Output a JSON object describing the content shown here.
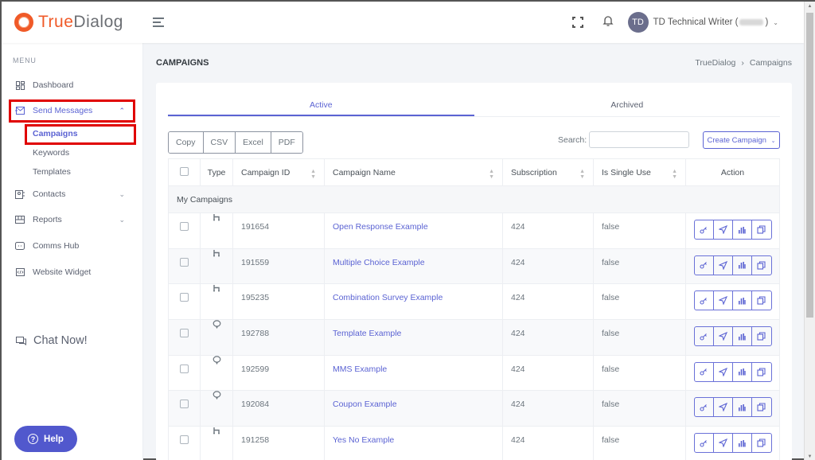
{
  "header": {
    "logo": {
      "part1": "True",
      "part2": "Dialog"
    },
    "user": {
      "initials": "TD",
      "name": "TD Technical Writer (",
      "suffix": ")"
    }
  },
  "sidebar": {
    "menu_title": "MENU",
    "items": [
      {
        "label": "Dashboard",
        "icon": "dashboard-icon"
      },
      {
        "label": "Send Messages",
        "icon": "send-messages-icon",
        "expanded": true,
        "active": true
      },
      {
        "label": "Contacts",
        "icon": "contacts-icon"
      },
      {
        "label": "Reports",
        "icon": "reports-icon"
      },
      {
        "label": "Comms Hub",
        "icon": "comms-hub-icon"
      },
      {
        "label": "Website Widget",
        "icon": "website-widget-icon"
      }
    ],
    "sub_items": [
      {
        "label": "Campaigns",
        "active": true
      },
      {
        "label": "Keywords"
      },
      {
        "label": "Templates"
      }
    ],
    "chat_now": "Chat Now!",
    "help": "Help"
  },
  "page": {
    "title": "CAMPAIGNS",
    "breadcrumb": [
      "TrueDialog",
      "Campaigns"
    ],
    "breadcrumb_sep": "›"
  },
  "tabs": [
    {
      "label": "Active",
      "active": true
    },
    {
      "label": "Archived"
    }
  ],
  "toolbar": {
    "export_buttons": [
      "Copy",
      "CSV",
      "Excel",
      "PDF"
    ],
    "search_label": "Search:",
    "search_value": "",
    "create_label": "Create Campaign"
  },
  "table": {
    "columns": [
      "",
      "Type",
      "Campaign ID",
      "Campaign Name",
      "Subscription",
      "Is Single Use",
      "Action"
    ],
    "group_label": "My Campaigns",
    "rows": [
      {
        "type": "survey",
        "id": "191654",
        "name": "Open Response Example",
        "subscription": "424",
        "single_use": "false"
      },
      {
        "type": "survey",
        "id": "191559",
        "name": "Multiple Choice Example",
        "subscription": "424",
        "single_use": "false"
      },
      {
        "type": "survey",
        "id": "195235",
        "name": "Combination Survey Example",
        "subscription": "424",
        "single_use": "false"
      },
      {
        "type": "message",
        "id": "192788",
        "name": "Template Example",
        "subscription": "424",
        "single_use": "false"
      },
      {
        "type": "message",
        "id": "192599",
        "name": "MMS Example",
        "subscription": "424",
        "single_use": "false"
      },
      {
        "type": "message",
        "id": "192084",
        "name": "Coupon Example",
        "subscription": "424",
        "single_use": "false"
      },
      {
        "type": "survey",
        "id": "191258",
        "name": "Yes No Example",
        "subscription": "424",
        "single_use": "false"
      }
    ],
    "action_icons": [
      "key-icon",
      "send-icon",
      "chart-icon",
      "copy-icon"
    ]
  },
  "colors": {
    "accent": "#5b63d3",
    "logo_orange": "#f05a28",
    "highlight_red": "#e00000",
    "help_button": "#5158cd"
  }
}
